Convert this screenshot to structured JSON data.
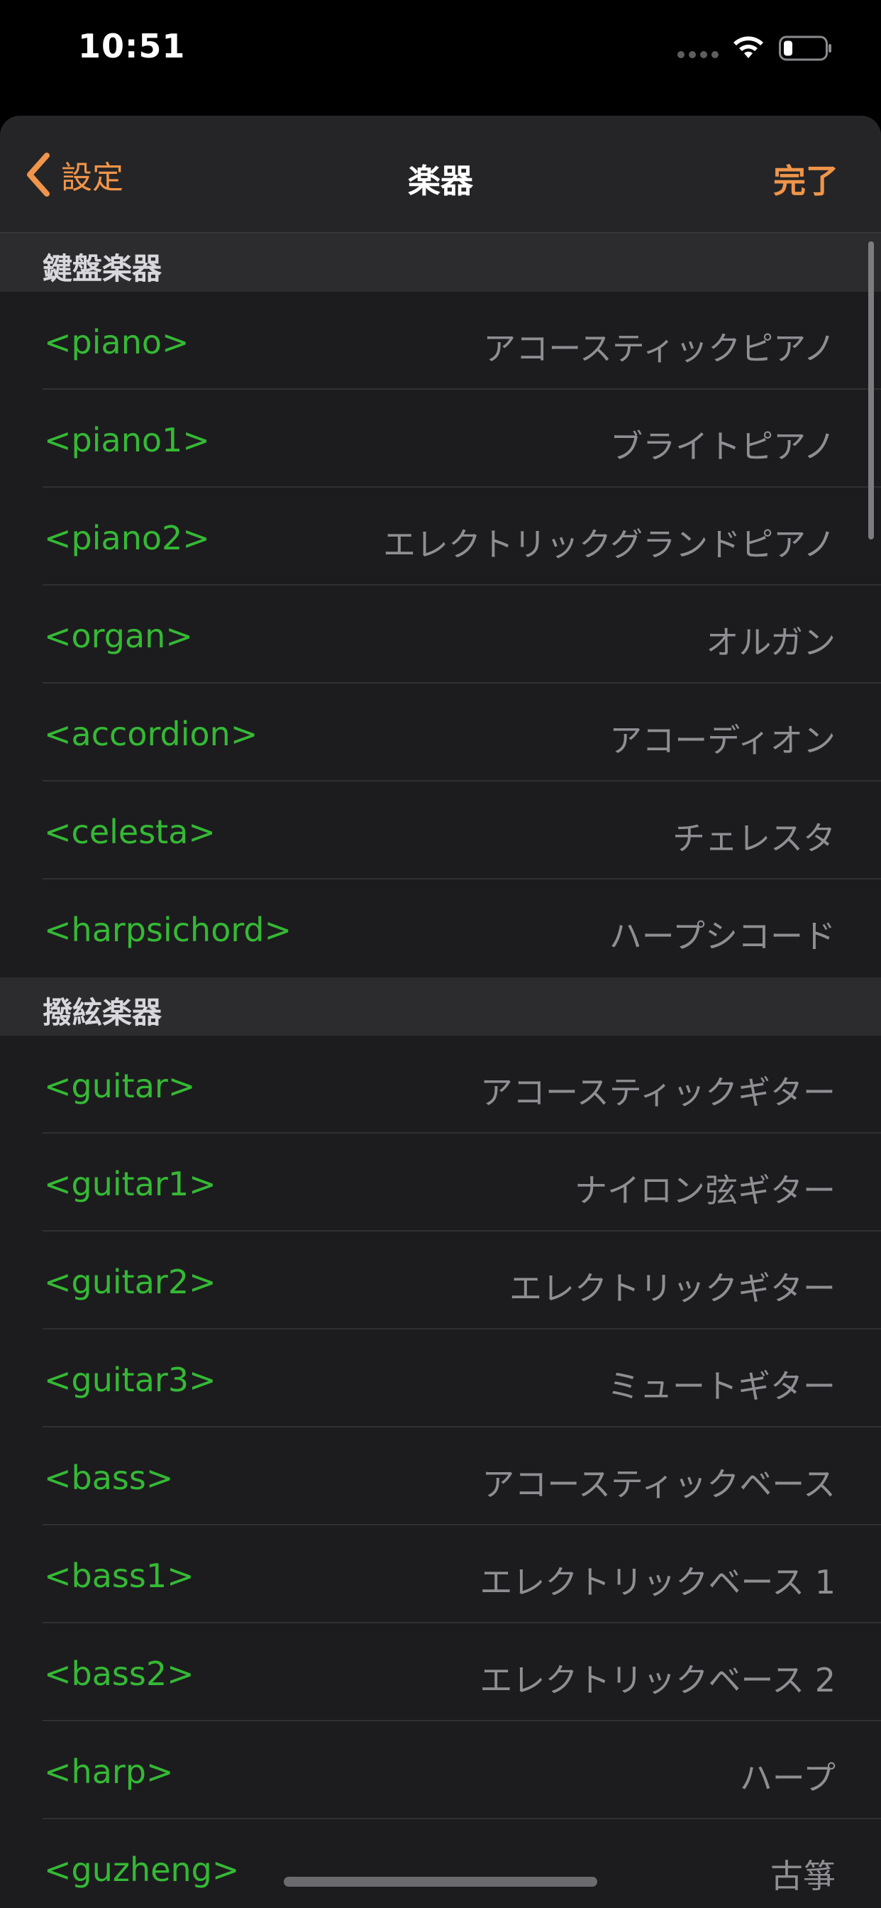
{
  "status_bar": {
    "time": "10:51"
  },
  "nav": {
    "back_label": "設定",
    "title": "楽器",
    "done_label": "完了"
  },
  "colors": {
    "accent": "#f0954a",
    "tag_green": "#35b935",
    "desc_gray": "#8e8e93"
  },
  "icons": [
    "chevron-left-icon",
    "wifi-icon",
    "battery-icon",
    "cellular-signal-icon"
  ],
  "sections": [
    {
      "header": "鍵盤楽器",
      "items": [
        {
          "tag": "<piano>",
          "name": "アコースティックピアノ"
        },
        {
          "tag": "<piano1>",
          "name": "ブライトピアノ"
        },
        {
          "tag": "<piano2>",
          "name": "エレクトリックグランドピアノ"
        },
        {
          "tag": "<organ>",
          "name": "オルガン"
        },
        {
          "tag": "<accordion>",
          "name": "アコーディオン"
        },
        {
          "tag": "<celesta>",
          "name": "チェレスタ"
        },
        {
          "tag": "<harpsichord>",
          "name": "ハープシコード"
        }
      ]
    },
    {
      "header": "撥絃楽器",
      "items": [
        {
          "tag": "<guitar>",
          "name": "アコースティックギター"
        },
        {
          "tag": "<guitar1>",
          "name": "ナイロン弦ギター"
        },
        {
          "tag": "<guitar2>",
          "name": "エレクトリックギター"
        },
        {
          "tag": "<guitar3>",
          "name": "ミュートギター"
        },
        {
          "tag": "<bass>",
          "name": "アコースティックベース"
        },
        {
          "tag": "<bass1>",
          "name": "エレクトリックベース 1"
        },
        {
          "tag": "<bass2>",
          "name": "エレクトリックベース 2"
        },
        {
          "tag": "<harp>",
          "name": "ハープ"
        },
        {
          "tag": "<guzheng>",
          "name": "古箏"
        }
      ]
    }
  ]
}
